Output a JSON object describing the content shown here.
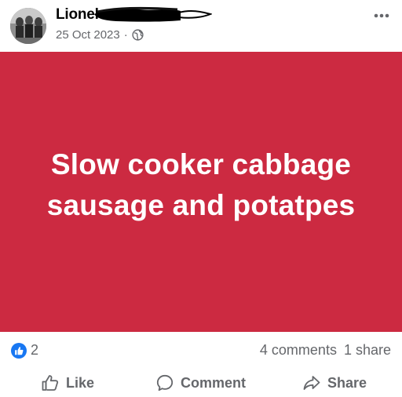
{
  "post": {
    "author": "Lionel",
    "date": "25 Oct 2023",
    "separator": "·",
    "privacy_icon": "globe-icon",
    "more_icon": "more-options-icon",
    "image_text": "Slow cooker cabbage sausage and potatpes",
    "image_background": "#cc2a41"
  },
  "stats": {
    "reaction_icon": "like-reaction-icon",
    "reaction_count": "2",
    "comments": "4 comments",
    "shares": "1 share"
  },
  "actions": {
    "like_label": "Like",
    "comment_label": "Comment",
    "share_label": "Share"
  },
  "colors": {
    "accent": "#1877f2",
    "secondary_text": "#65676b"
  }
}
